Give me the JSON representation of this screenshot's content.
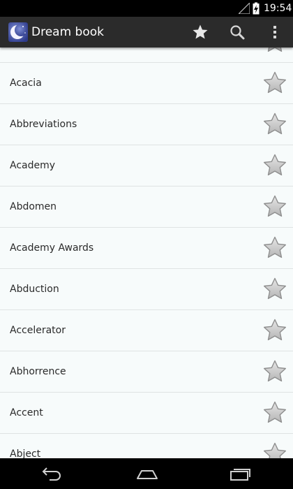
{
  "status_bar": {
    "time": "19:54",
    "icons": [
      "signal-icon",
      "battery-charging-icon"
    ]
  },
  "action_bar": {
    "title": "Dream book",
    "logo": "moon-logo-icon",
    "actions": [
      "favorites-star-icon",
      "search-icon",
      "overflow-menu-icon"
    ]
  },
  "list": {
    "items": [
      {
        "label": ""
      },
      {
        "label": "Acacia"
      },
      {
        "label": "Abbreviations"
      },
      {
        "label": "Academy"
      },
      {
        "label": "Abdomen"
      },
      {
        "label": "Academy Awards"
      },
      {
        "label": "Abduction"
      },
      {
        "label": "Accelerator"
      },
      {
        "label": "Abhorrence"
      },
      {
        "label": "Accent"
      },
      {
        "label": "Abject"
      }
    ]
  },
  "nav_bar": {
    "buttons": [
      "back-icon",
      "home-icon",
      "recent-apps-icon"
    ]
  },
  "colors": {
    "background": "#f7fbfb",
    "action_bar": "#2b2b2b",
    "divider": "#dfe3e3"
  }
}
